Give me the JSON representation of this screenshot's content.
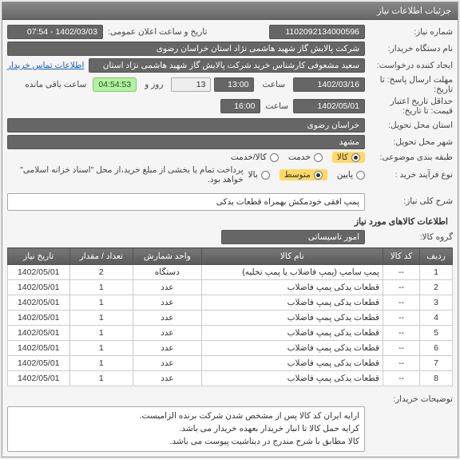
{
  "panel_title": "جزئیات اطلاعات نیاز",
  "labels": {
    "need_no": "شماره نیاز:",
    "public_dt": "تاریخ و ساعت اعلان عمومی:",
    "buyer": "نام دستگاه خریدار:",
    "requester": "ایجاد کننده درخواست:",
    "contact_link": "اطلاعات تماس خریدار",
    "deadline": "مهلت ارسال پاسخ: تا تاریخ:",
    "hour": "ساعت",
    "day": "روز و",
    "remain": "ساعت باقی مانده",
    "valid": "حداقل تاریخ اعتبار قیمت: تا تاریخ:",
    "province": "استان محل تحویل:",
    "city": "شهر محل تحویل:",
    "category": "طبقه بندی موضوعی:",
    "buy_type": "نوع فرآیند خرید :",
    "pay_note": "پرداخت تمام یا بخشی از مبلغ خرید،از محل \"اسناد خزانه اسلامی\" خواهد بود.",
    "need_title": "شرح کلی نیاز:",
    "goods_info": "اطلاعات کالاهای مورد نیاز",
    "group": "گروه کالا:",
    "buyer_desc": "توضیحات خریدار:"
  },
  "values": {
    "need_no": "1102092134000596",
    "public_dt": "1402/03/03 - 07:54",
    "buyer": "شرکت پالایش گاز شهید هاشمی نژاد   استان خراسان رضوی",
    "requester": "سعید مشعوفی کارشناس خرید شرکت پالایش گاز شهید هاشمی نژاد   استان",
    "deadline_date": "1402/03/16",
    "deadline_time": "13:00",
    "days": "13",
    "countdown": "04:54:53",
    "valid_date": "1402/05/01",
    "valid_time": "16:00",
    "province": "خراسان رضوی",
    "city": "مشهد",
    "need_title": "پمپ افقی خودمکش بهمراه قطعات یدکی",
    "group": "امور تاسیساتی",
    "buyer_desc_1": "ارایه ایران کد کالا پس از مشخص شدن شرکت برنده الزامیست.",
    "buyer_desc_2": "کرایه حمل کالا تا انبار خریدار بعهده خریدار می باشد.",
    "buyer_desc_3": "کالا مطابق با شرح مندرج در دیتاشیت پیوست می باشد."
  },
  "category_opts": {
    "goods": "کالا",
    "service": "خدمت",
    "both": "کالا/خدمت"
  },
  "buy_opts": {
    "low": "پایین",
    "mid": "متوسط",
    "high": "بالا"
  },
  "table": {
    "headers": {
      "row": "ردیف",
      "code": "کد کالا",
      "name": "نام کالا",
      "unit": "واحد شمارش",
      "qty": "تعداد / مقدار",
      "date": "تاریخ نیاز"
    },
    "rows": [
      {
        "r": "1",
        "code": "--",
        "name": "پمپ سامپ (پمپ فاضلاب یا پمپ تخلیه)",
        "unit": "دستگاه",
        "qty": "2",
        "date": "1402/05/01"
      },
      {
        "r": "2",
        "code": "--",
        "name": "قطعات یدکی پمپ فاضلاب",
        "unit": "عدد",
        "qty": "1",
        "date": "1402/05/01"
      },
      {
        "r": "3",
        "code": "--",
        "name": "قطعات یدکی پمپ فاضلاب",
        "unit": "عدد",
        "qty": "1",
        "date": "1402/05/01"
      },
      {
        "r": "4",
        "code": "--",
        "name": "قطعات یدکی پمپ فاضلاب",
        "unit": "عدد",
        "qty": "1",
        "date": "1402/05/01"
      },
      {
        "r": "5",
        "code": "--",
        "name": "قطعات یدکی پمپ فاضلاب",
        "unit": "عدد",
        "qty": "1",
        "date": "1402/05/01"
      },
      {
        "r": "6",
        "code": "--",
        "name": "قطعات یدکی پمپ فاضلاب",
        "unit": "عدد",
        "qty": "1",
        "date": "1402/05/01"
      },
      {
        "r": "7",
        "code": "--",
        "name": "قطعات یدکی پمپ فاضلاب",
        "unit": "عدد",
        "qty": "1",
        "date": "1402/05/01"
      },
      {
        "r": "8",
        "code": "--",
        "name": "قطعات یدکی پمپ فاضلاب",
        "unit": "عدد",
        "qty": "1",
        "date": "1402/05/01"
      }
    ]
  }
}
